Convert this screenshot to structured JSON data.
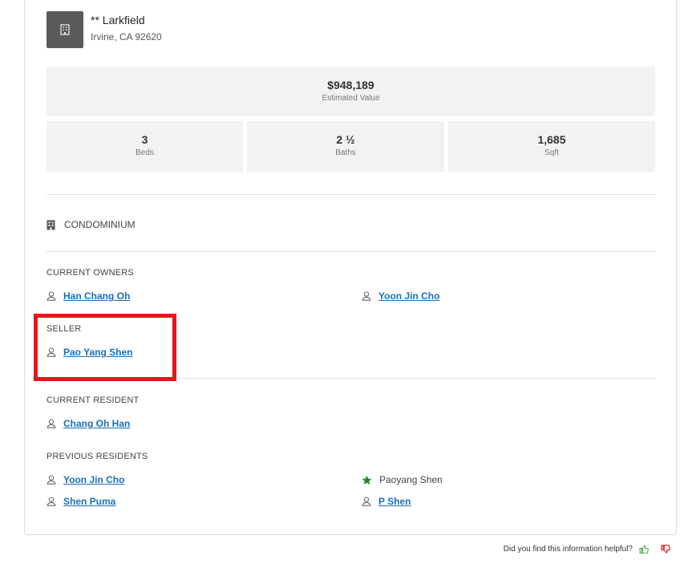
{
  "property": {
    "street": "** Larkfield",
    "city_state_zip": "Irvine, CA 92620",
    "estimated_value": "$948,189",
    "estimated_value_label": "Estimated Value",
    "stats": [
      {
        "value": "3",
        "label": "Beds"
      },
      {
        "value": "2 ½",
        "label": "Baths"
      },
      {
        "value": "1,685",
        "label": "Sqft"
      }
    ],
    "type": "CONDOMINIUM"
  },
  "current_owners": {
    "title": "CURRENT OWNERS",
    "people": [
      "Han Chang Oh",
      "Yoon Jin Cho"
    ]
  },
  "seller": {
    "title": "SELLER",
    "people": [
      "Pao Yang Shen"
    ]
  },
  "current_resident": {
    "title": "CURRENT RESIDENT",
    "people": [
      "Chang Oh Han"
    ]
  },
  "previous_residents": {
    "title": "PREVIOUS RESIDENTS",
    "people": [
      "Yoon Jin Cho",
      "Paoyang Shen",
      "Shen Puma",
      "P Shen"
    ]
  },
  "feedback": {
    "question": "Did you find this information helpful?"
  },
  "colors": {
    "link": "#1a6fb5",
    "highlight": "#e8151b",
    "star": "#1e8a2a",
    "thumbs_up": "#4caf50",
    "thumbs_down": "#e53935"
  },
  "icons": {
    "building": "building-icon",
    "person": "person-icon",
    "star": "star-icon",
    "thumbs_up": "thumbs-up-icon",
    "thumbs_down": "thumbs-down-icon"
  }
}
